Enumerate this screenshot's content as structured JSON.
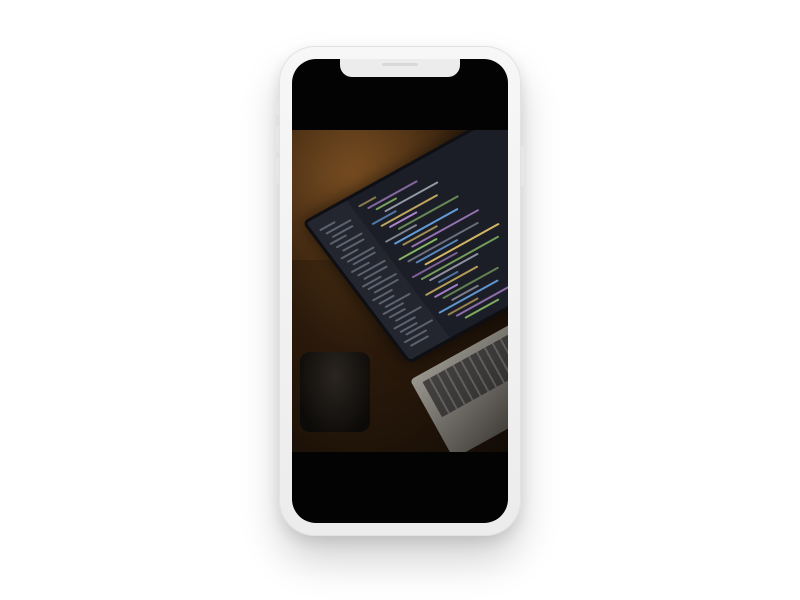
{
  "scene": {
    "subject": "smartphone-mockup",
    "screen_content": "photo",
    "colors": {
      "background": "#ffffff",
      "phone_body": "#f0f0f0",
      "screen_bezel": "#030303",
      "editor_bg": "#1b1d27",
      "code_yellow": "#e6c76a",
      "code_green": "#8fc26a",
      "code_blue": "#6aa6e6",
      "code_purple": "#b58ad6",
      "code_gray": "#9aa0ad"
    }
  }
}
